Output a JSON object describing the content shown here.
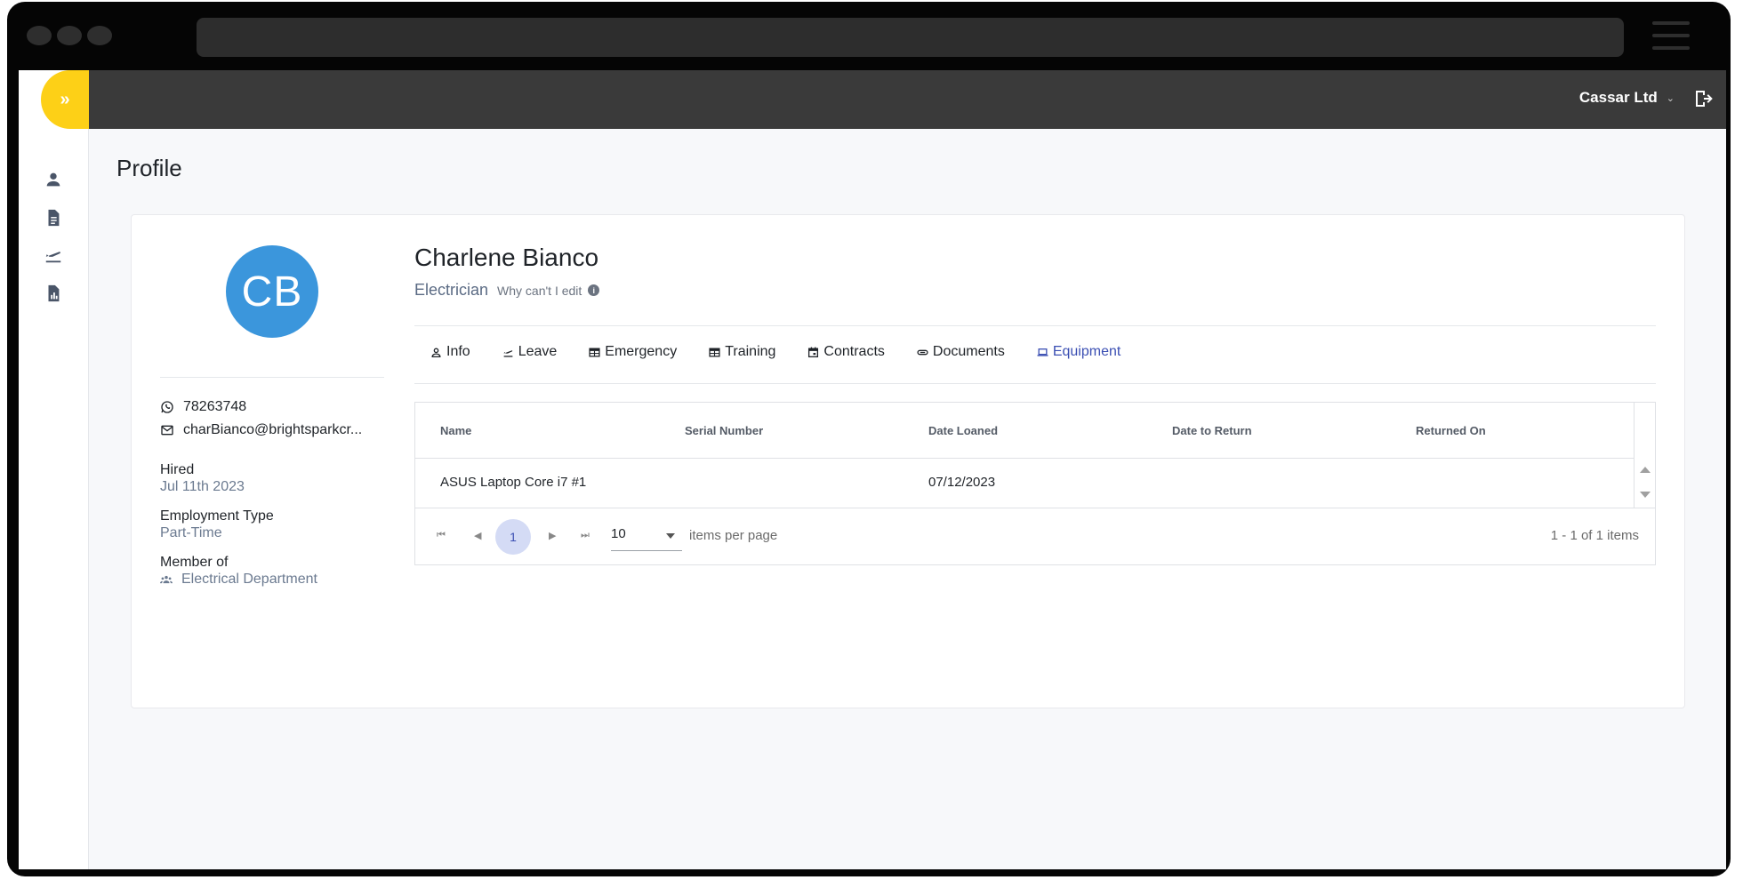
{
  "header": {
    "expand_icon": "double-chevron-right-icon",
    "company": "Cassar Ltd",
    "logout_icon": "logout-icon",
    "accent_color": "#fdd017"
  },
  "sidebar": {
    "items": [
      {
        "name": "profile",
        "icon": "user-icon"
      },
      {
        "name": "documents",
        "icon": "document-icon"
      },
      {
        "name": "leave",
        "icon": "plane-departure-icon"
      },
      {
        "name": "reports",
        "icon": "report-icon"
      }
    ]
  },
  "page": {
    "title": "Profile"
  },
  "profile": {
    "initials": "CB",
    "name": "Charlene Bianco",
    "role": "Electrician",
    "why_cant_edit": "Why can't I edit",
    "phone": "78263748",
    "email": "charBianco@brightsparkcr...",
    "hired_label": "Hired",
    "hired_value": "Jul 11th 2023",
    "employment_type_label": "Employment Type",
    "employment_type_value": "Part-Time",
    "member_of_label": "Member of",
    "member_of_value": "Electrical Department",
    "avatar_color": "#3b96dc"
  },
  "tabs": [
    {
      "label": "Info",
      "icon": "user-icon",
      "active": false
    },
    {
      "label": "Leave",
      "icon": "plane-departure-icon",
      "active": false
    },
    {
      "label": "Emergency",
      "icon": "table-icon",
      "active": false
    },
    {
      "label": "Training",
      "icon": "table-icon",
      "active": false
    },
    {
      "label": "Contracts",
      "icon": "calendar-icon",
      "active": false
    },
    {
      "label": "Documents",
      "icon": "link-icon",
      "active": false
    },
    {
      "label": "Equipment",
      "icon": "laptop-icon",
      "active": true
    }
  ],
  "equipment_table": {
    "columns": [
      "Name",
      "Serial Number",
      "Date Loaned",
      "Date to Return",
      "Returned On"
    ],
    "rows": [
      {
        "name": "ASUS Laptop Core i7 #1",
        "serial": "",
        "date_loaned": "07/12/2023",
        "date_to_return": "",
        "returned_on": ""
      }
    ],
    "pager": {
      "current_page": "1",
      "page_size": "10",
      "items_per_page_label": "items per page",
      "info": "1 - 1 of 1 items"
    }
  }
}
